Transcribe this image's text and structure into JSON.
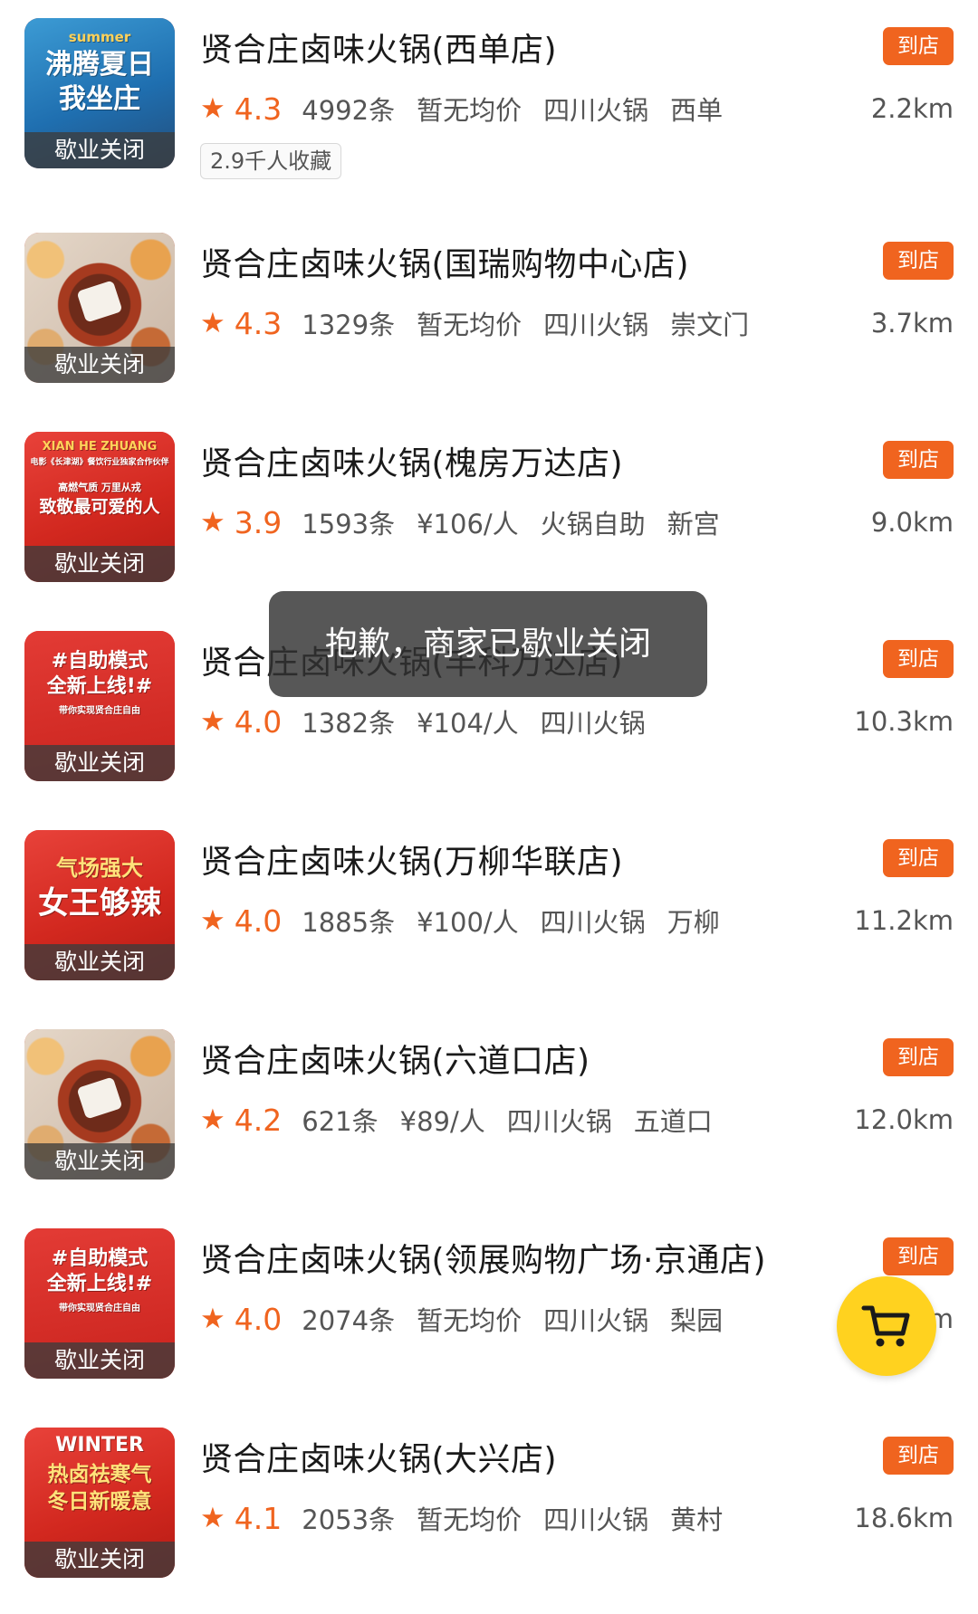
{
  "listings": [
    {
      "title": "贤合庄卤味火锅(西单店)",
      "tag": "到店",
      "rating": "4.3",
      "reviews": "4992条",
      "price": "暂无均价",
      "category": "四川火锅",
      "area": "西单",
      "distance": "2.2km",
      "status": "歇业关闭",
      "favorites": "2.9千人收藏",
      "thumb_text": [
        "summer",
        "沸腾夏日",
        "我坐庄"
      ]
    },
    {
      "title": "贤合庄卤味火锅(国瑞购物中心店)",
      "tag": "到店",
      "rating": "4.3",
      "reviews": "1329条",
      "price": "暂无均价",
      "category": "四川火锅",
      "area": "崇文门",
      "distance": "3.7km",
      "status": "歇业关闭"
    },
    {
      "title": "贤合庄卤味火锅(槐房万达店)",
      "tag": "到店",
      "rating": "3.9",
      "reviews": "1593条",
      "price": "¥106/人",
      "category": "火锅自助",
      "area": "新宫",
      "distance": "9.0km",
      "status": "歇业关闭",
      "thumb_text": [
        "XIAN HE ZHUANG",
        "电影《长津湖》餐饮行业独家合作伙伴",
        "高燃气质 万里从戎",
        "致敬最可爱的人"
      ]
    },
    {
      "title": "贤合庄卤味火锅(丰科万达店)",
      "tag": "到店",
      "rating": "4.0",
      "reviews": "1382条",
      "price": "¥104/人",
      "category": "四川火锅",
      "area": "",
      "distance": "10.3km",
      "status": "歇业关闭",
      "thumb_text": [
        "#自助模式",
        "全新上线!#",
        "带你实现贤合庄自由"
      ]
    },
    {
      "title": "贤合庄卤味火锅(万柳华联店)",
      "tag": "到店",
      "rating": "4.0",
      "reviews": "1885条",
      "price": "¥100/人",
      "category": "四川火锅",
      "area": "万柳",
      "distance": "11.2km",
      "status": "歇业关闭",
      "thumb_text": [
        "气场强大",
        "女王够辣"
      ]
    },
    {
      "title": "贤合庄卤味火锅(六道口店)",
      "tag": "到店",
      "rating": "4.2",
      "reviews": "621条",
      "price": "¥89/人",
      "category": "四川火锅",
      "area": "五道口",
      "distance": "12.0km",
      "status": "歇业关闭"
    },
    {
      "title": "贤合庄卤味火锅(领展购物广场·京通店)",
      "tag": "到店",
      "rating": "4.0",
      "reviews": "2074条",
      "price": "暂无均价",
      "category": "四川火锅",
      "area": "梨园",
      "distance": "m",
      "status": "歇业关闭",
      "thumb_text": [
        "#自助模式",
        "全新上线!#",
        "带你实现贤合庄自由"
      ]
    },
    {
      "title": "贤合庄卤味火锅(大兴店)",
      "tag": "到店",
      "rating": "4.1",
      "reviews": "2053条",
      "price": "暂无均价",
      "category": "四川火锅",
      "area": "黄村",
      "distance": "18.6km",
      "status": "歇业关闭",
      "thumb_text": [
        "WINTER",
        "热卤祛寒气",
        "冬日新暖意"
      ]
    }
  ],
  "toast": "抱歉，商家已歇业关闭",
  "cart": {
    "icon": "shopping-cart-icon"
  },
  "colors": {
    "accent": "#f0641f",
    "cart": "#ffd21f",
    "toast_bg": "#3a3a3a"
  }
}
